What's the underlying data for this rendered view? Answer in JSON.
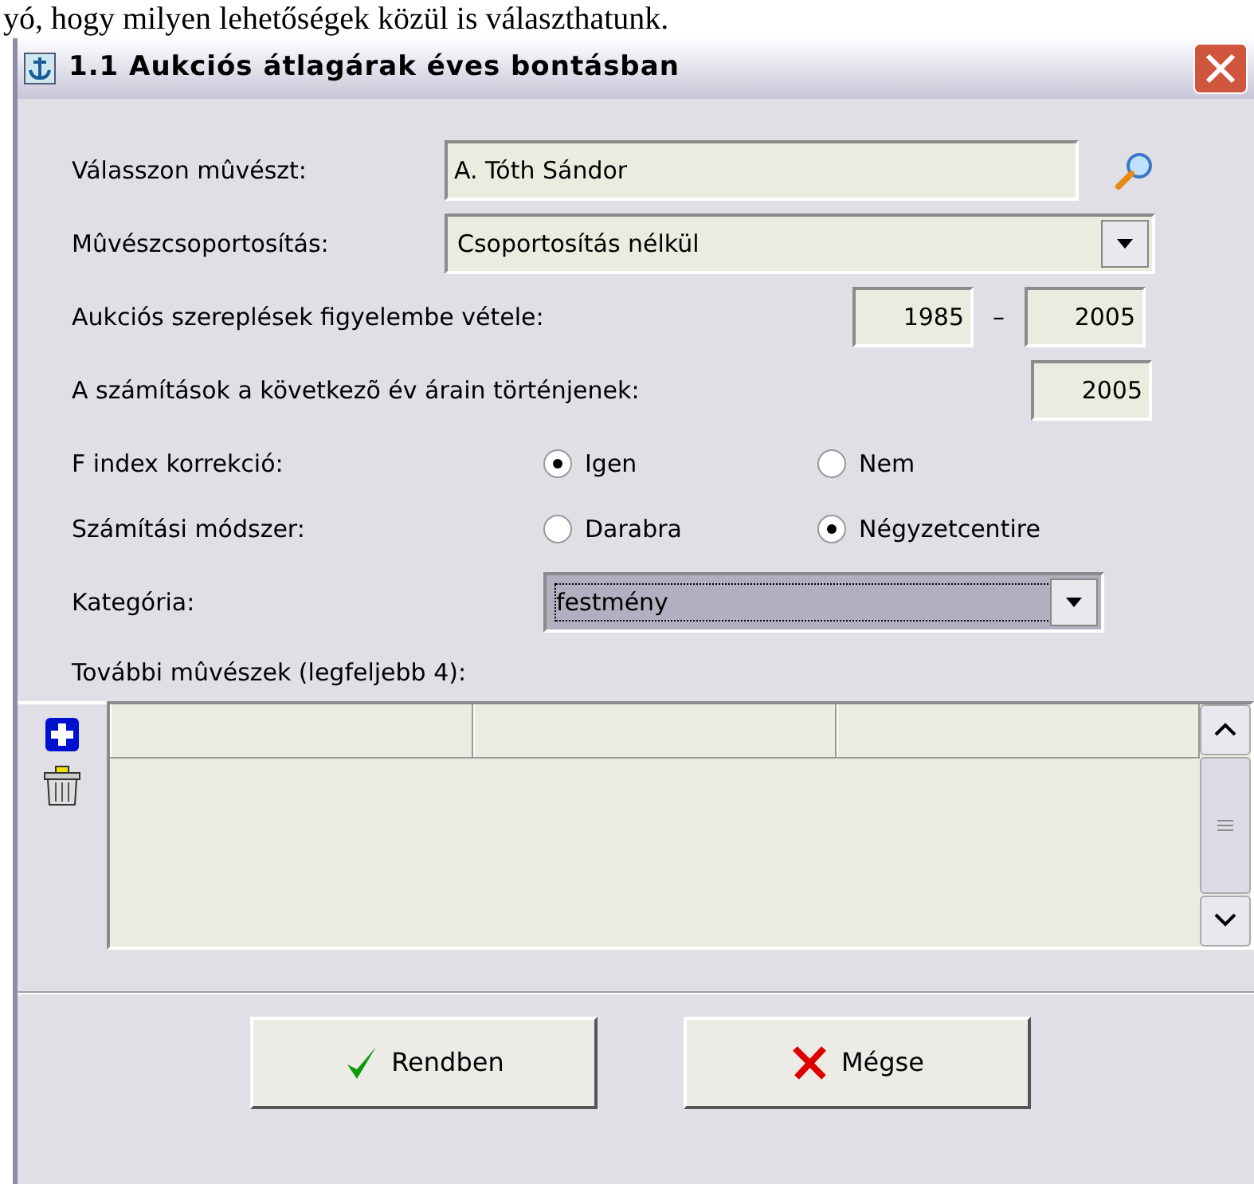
{
  "document_text": "yó, hogy milyen lehetőségek közül is választhatunk.",
  "window": {
    "title": "1.1 Aukciós átlagárak éves bontásban"
  },
  "artist": {
    "label": "Válasszon mûvészt:",
    "value": "A. Tóth Sándor"
  },
  "grouping": {
    "label": "Mûvészcsoportosítás:",
    "value": "Csoportosítás nélkül"
  },
  "period": {
    "label": "Aukciós szereplések figyelembe vétele:",
    "from": "1985",
    "separator": "–",
    "to": "2005"
  },
  "price_year": {
    "label": "A számítások a következõ év árain történjenek:",
    "value": "2005"
  },
  "radio_groups": [
    {
      "label": "F index korrekció:",
      "options": [
        {
          "label": "Igen",
          "selected": true
        },
        {
          "label": "Nem",
          "selected": false
        }
      ]
    },
    {
      "label": "Számítási módszer:",
      "options": [
        {
          "label": "Darabra",
          "selected": false
        },
        {
          "label": "Négyzetcentire",
          "selected": true
        }
      ]
    }
  ],
  "category": {
    "label": "Kategória:",
    "value": "festmény",
    "focused": true
  },
  "artists_table": {
    "label": "További mûvészek (legfeljebb 4):"
  },
  "buttons": [
    {
      "label": "Rendben",
      "kind": "ok"
    },
    {
      "label": "Mégse",
      "kind": "cancel"
    }
  ]
}
